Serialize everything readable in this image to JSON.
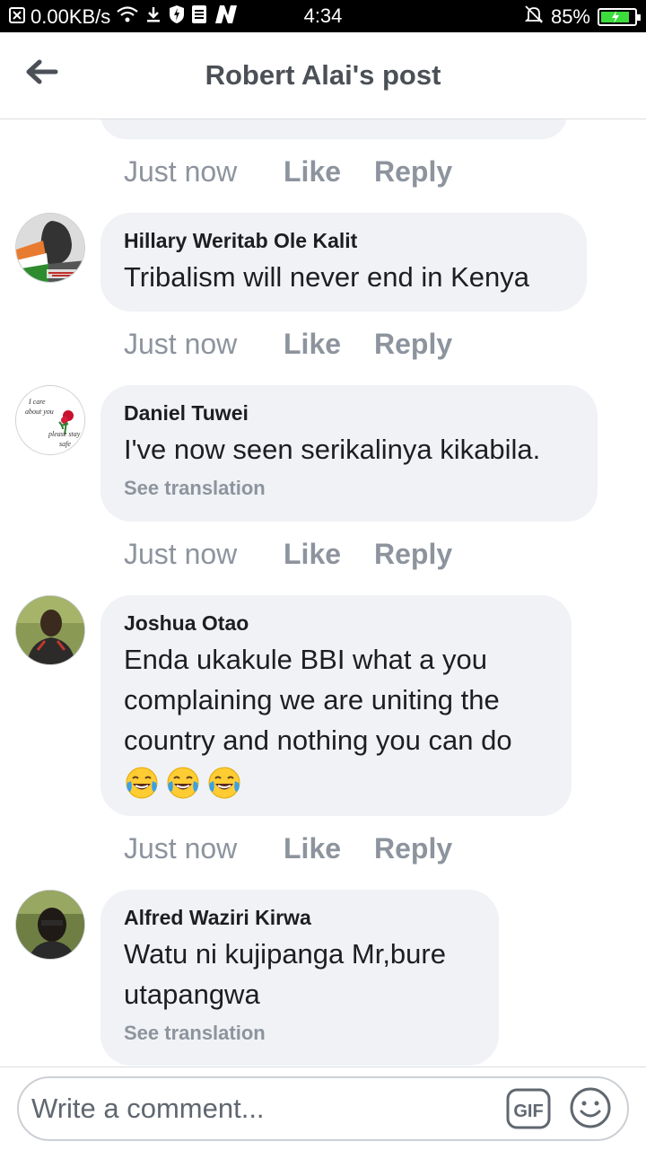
{
  "status_bar": {
    "network_speed": "0.00KB/s",
    "time": "4:34",
    "battery_percent": "85%",
    "battery_level": 0.85
  },
  "header": {
    "title": "Robert Alai's post"
  },
  "comments": [
    {
      "author": "",
      "text": "",
      "time": "Just now",
      "like_label": "Like",
      "reply_label": "Reply"
    },
    {
      "author": "Hillary Weritab Ole Kalit",
      "text": "Tribalism will never end in Kenya",
      "time": "Just now",
      "like_label": "Like",
      "reply_label": "Reply"
    },
    {
      "author": "Daniel Tuwei",
      "text": "I've now seen serikalinya kikabila.",
      "see_translation": "See translation",
      "time": "Just now",
      "like_label": "Like",
      "reply_label": "Reply",
      "avatar_text": {
        "line1": "I care",
        "line2": "about you",
        "line3": "please stay",
        "line4": "safe"
      }
    },
    {
      "author": "Joshua Otao",
      "text_line1": "Enda ukakule BBI what a you",
      "text_line2": "complaining we are uniting the",
      "text_line3": "country and nothing you can do",
      "emoji": [
        "face-with-tears-of-joy",
        "face-with-tears-of-joy",
        "face-with-tears-of-joy"
      ],
      "time": "Just now",
      "like_label": "Like",
      "reply_label": "Reply"
    },
    {
      "author": "Alfred Waziri Kirwa",
      "text_line1": "Watu ni kujipanga Mr,bure",
      "text_line2": "utapangwa",
      "see_translation": "See translation"
    }
  ],
  "composer": {
    "placeholder": "Write a comment...",
    "gif_label": "GIF"
  },
  "colors": {
    "bubble": "#f0f2f5",
    "muted_text": "#8d949e",
    "title_text": "#4b4f56",
    "battery_green": "#3ddc3d"
  }
}
